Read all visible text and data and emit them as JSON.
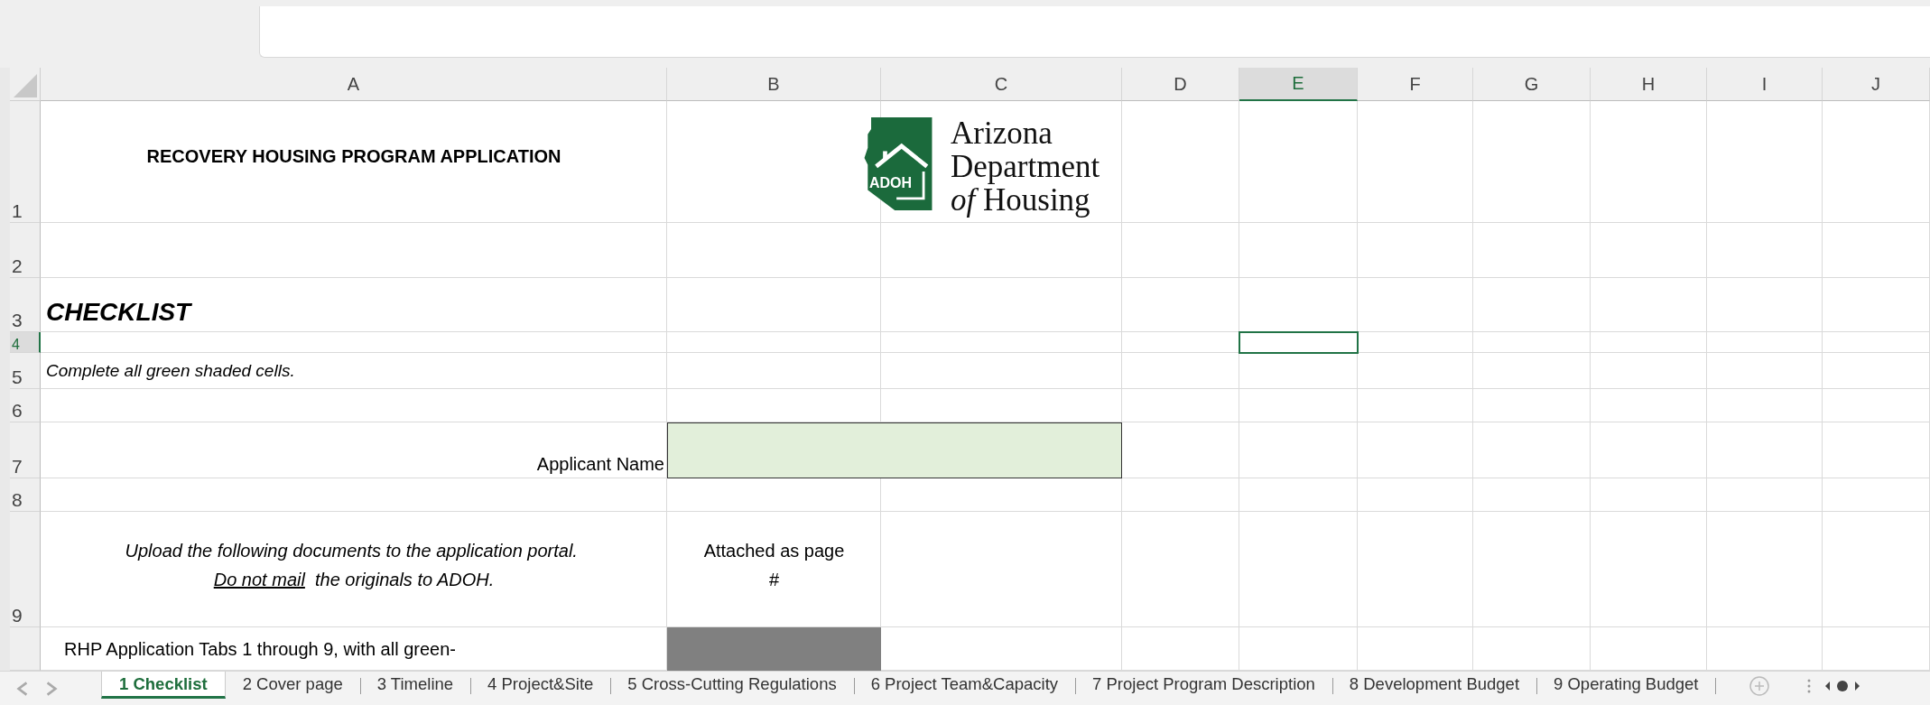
{
  "columns": [
    {
      "label": "A",
      "selected": false
    },
    {
      "label": "B",
      "selected": false
    },
    {
      "label": "C",
      "selected": false
    },
    {
      "label": "D",
      "selected": false
    },
    {
      "label": "E",
      "selected": true
    },
    {
      "label": "F",
      "selected": false
    },
    {
      "label": "G",
      "selected": false
    },
    {
      "label": "H",
      "selected": false
    },
    {
      "label": "I",
      "selected": false
    },
    {
      "label": "J",
      "selected": false
    }
  ],
  "rows": [
    {
      "label": "1",
      "selected": false
    },
    {
      "label": "2",
      "selected": false
    },
    {
      "label": "3",
      "selected": false
    },
    {
      "label": "4",
      "selected": true
    },
    {
      "label": "5",
      "selected": false
    },
    {
      "label": "6",
      "selected": false
    },
    {
      "label": "7",
      "selected": false
    },
    {
      "label": "8",
      "selected": false
    },
    {
      "label": "9",
      "selected": false
    }
  ],
  "title": "RECOVERY HOUSING PROGRAM APPLICATION",
  "logo": {
    "badge": "ADOH",
    "lines": [
      "Arizona",
      "Department",
      "*of* Housing"
    ]
  },
  "heading": "CHECKLIST",
  "instruction": "Complete all green shaded cells.",
  "applicant_name": {
    "label": "Applicant Name"
  },
  "upload_note": {
    "before": "Upload the following documents to the application portal.",
    "underlined": "Do not mail",
    "after": "the originals to ADOH."
  },
  "attached_header": "Attached as page #",
  "first_item": "RHP Application Tabs 1 through 9, with all green-",
  "sheet_tabs": [
    {
      "label": "1 Checklist",
      "selected": true
    },
    {
      "label": "2 Cover page",
      "selected": false
    },
    {
      "label": "3 Timeline",
      "selected": false
    },
    {
      "label": "4 Project&Site",
      "selected": false
    },
    {
      "label": "5 Cross-Cutting Regulations",
      "selected": false
    },
    {
      "label": "6 Project Team&Capacity",
      "selected": false
    },
    {
      "label": "7 Project Program Description",
      "selected": false
    },
    {
      "label": "8 Development Budget",
      "selected": false
    },
    {
      "label": "9 Operating Budget",
      "selected": false
    }
  ]
}
